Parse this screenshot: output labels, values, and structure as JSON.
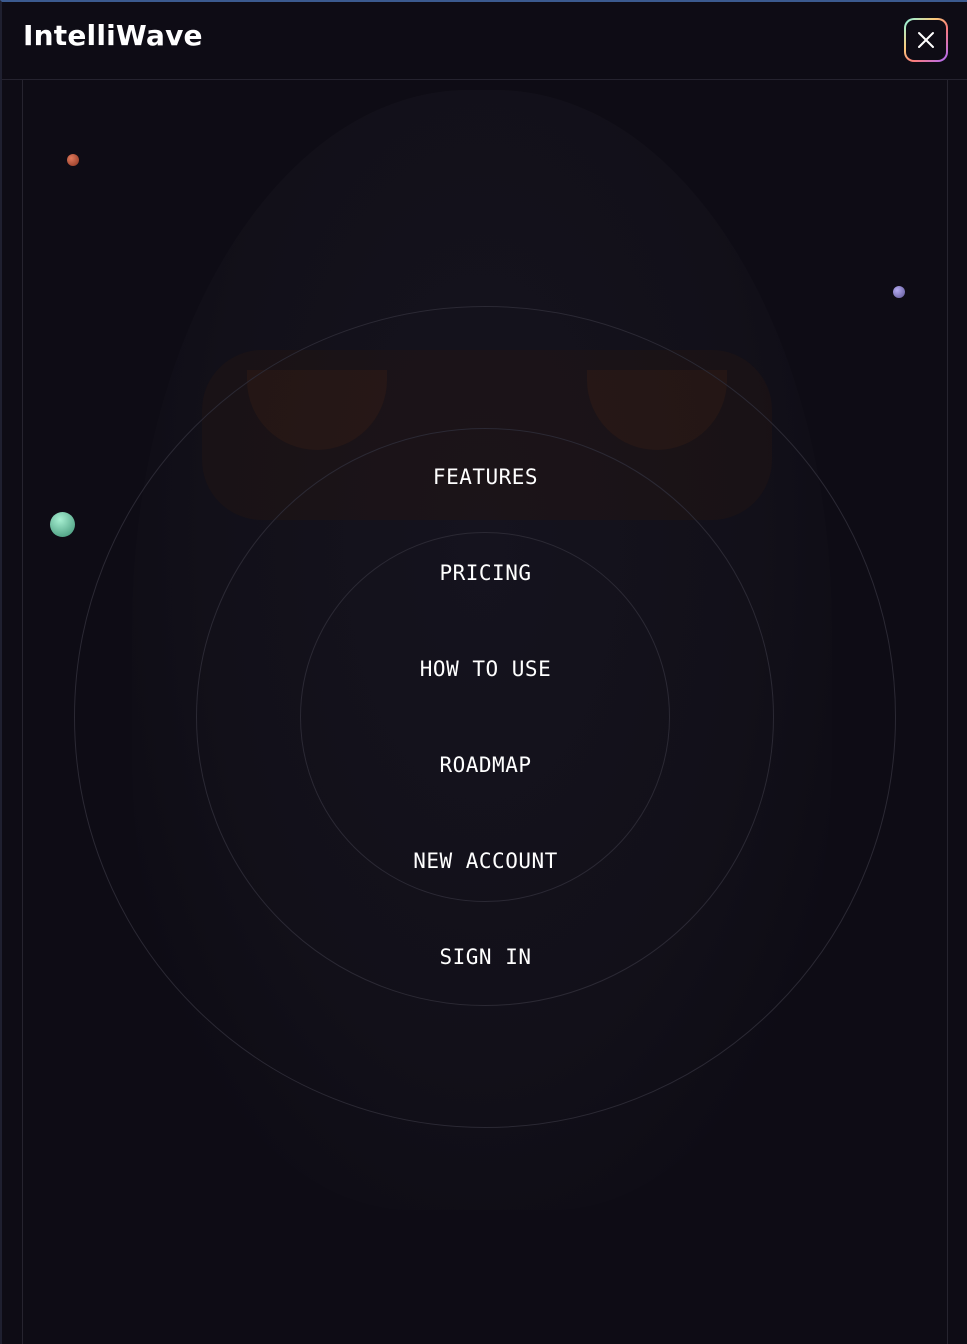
{
  "header": {
    "logo": "IntelliWave",
    "close_icon": "close-icon"
  },
  "menu": {
    "items": [
      {
        "label": "FEATURES"
      },
      {
        "label": "PRICING"
      },
      {
        "label": "HOW TO USE"
      },
      {
        "label": "ROADMAP"
      },
      {
        "label": "NEW ACCOUNT"
      },
      {
        "label": "SIGN IN"
      }
    ]
  },
  "colors": {
    "background": "#0e0c15",
    "text": "#ffffff",
    "ring": "#2b2934",
    "dot_orange": "#c65b42",
    "dot_purple": "#8a80c4",
    "dot_green": "#7fe0b8"
  }
}
